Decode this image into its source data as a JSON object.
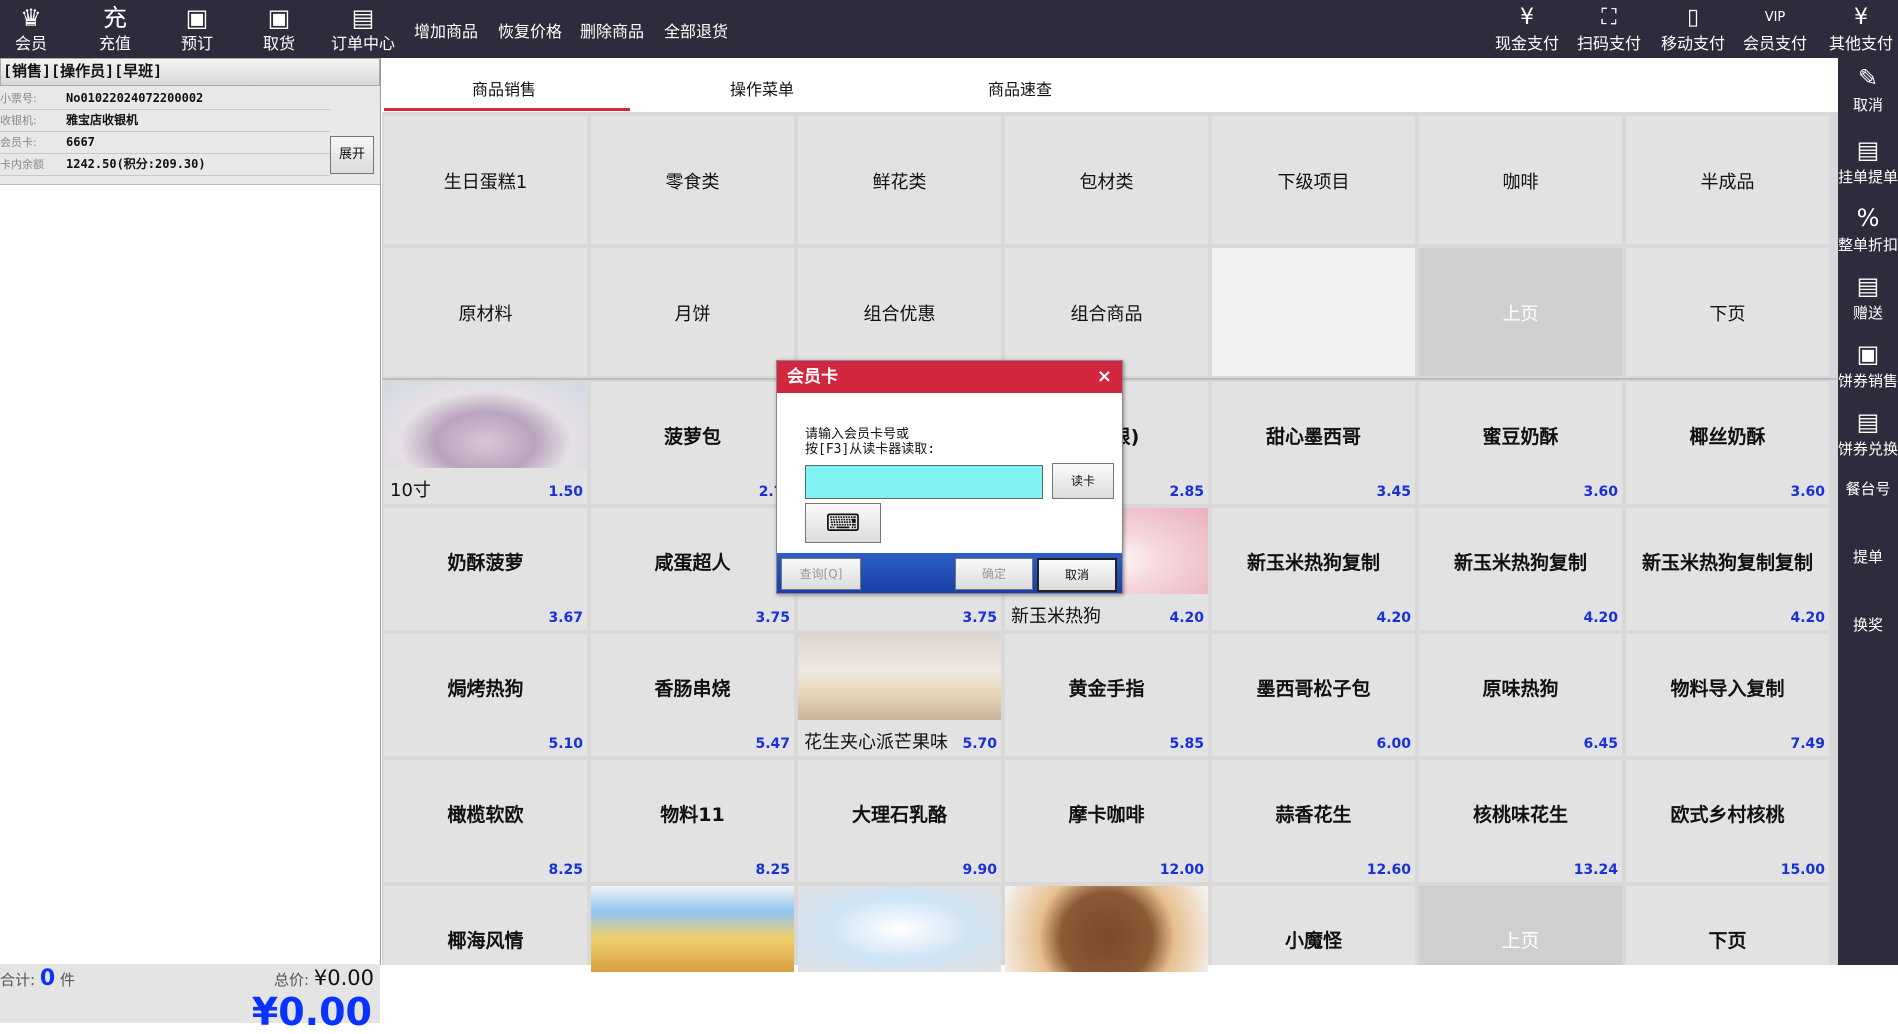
{
  "topbar": {
    "left_buttons": [
      {
        "label": "会员",
        "icon": "crown-icon",
        "glyph": "♛"
      },
      {
        "label": "充值",
        "icon": "recharge-icon",
        "glyph": "充"
      },
      {
        "label": "预订",
        "icon": "calendar-check-icon",
        "glyph": "▣"
      },
      {
        "label": "取货",
        "icon": "calendar-pickup-icon",
        "glyph": "▣"
      },
      {
        "label": "订单中心",
        "icon": "gift-box-icon",
        "glyph": "▤"
      }
    ],
    "links": [
      "增加商品",
      "恢复价格",
      "删除商品",
      "全部退货"
    ],
    "right_buttons": [
      {
        "label": "现金支付",
        "icon": "cash-icon",
        "glyph": "¥"
      },
      {
        "label": "扫码支付",
        "icon": "scan-icon",
        "glyph": "⛶"
      },
      {
        "label": "移动支付",
        "icon": "mobile-pay-icon",
        "glyph": "▯"
      },
      {
        "label": "会员支付",
        "icon": "vip-card-icon",
        "glyph": "VIP"
      },
      {
        "label": "其他支付",
        "icon": "other-pay-icon",
        "glyph": "¥"
      }
    ]
  },
  "left_panel": {
    "header": "[销售][操作员][早班]",
    "rows": [
      {
        "key": "小票号:",
        "value": "No01022024072200002"
      },
      {
        "key": "收银机:",
        "value": "雅宝店收银机"
      },
      {
        "key": "会员卡:",
        "value": "6667"
      },
      {
        "key": "卡内余额",
        "value": "1242.50(积分:209.30)"
      }
    ],
    "expand_label": "展开",
    "count_label": "合计:",
    "count_value": "0",
    "count_unit": "件",
    "total_label": "总价:",
    "total_value": "¥0.00",
    "big_total": "¥0.00"
  },
  "tabs": [
    "商品销售",
    "操作菜单",
    "商品速查"
  ],
  "categories": [
    [
      "生日蛋糕1",
      "零食类",
      "鲜花类",
      "包材类",
      "下级项目",
      "咖啡",
      "半成品"
    ],
    [
      "原材料",
      "月饼",
      "组合优惠",
      "组合商品",
      "",
      "上页",
      "下页"
    ]
  ],
  "products": [
    [
      {
        "name": "",
        "tag": "10寸",
        "price": "1.50",
        "img": "cake1"
      },
      {
        "name": "菠萝包",
        "price": "2.??"
      },
      {
        "name": "",
        "price": ""
      },
      {
        "name": "松培根)",
        "price": "2.85"
      },
      {
        "name": "甜心墨西哥",
        "price": "3.45"
      },
      {
        "name": "蜜豆奶酥",
        "price": "3.60"
      },
      {
        "name": "椰丝奶酥",
        "price": "3.60"
      }
    ],
    [
      {
        "name": "奶酥菠萝",
        "price": "3.67"
      },
      {
        "name": "咸蛋超人",
        "price": "3.75"
      },
      {
        "name": "",
        "price": "3.75"
      },
      {
        "name": "",
        "tag": "新玉米热狗",
        "price": "4.20",
        "img": "cake2"
      },
      {
        "name": "新玉米热狗复制",
        "price": "4.20"
      },
      {
        "name": "新玉米热狗复制",
        "price": "4.20"
      },
      {
        "name": "新玉米热狗复制复制",
        "price": "4.20"
      }
    ],
    [
      {
        "name": "焗烤热狗",
        "price": "5.10"
      },
      {
        "name": "香肠串烧",
        "price": "5.47"
      },
      {
        "name": "",
        "tag": "花生夹心派芒果味",
        "price": "5.70",
        "img": "cake3"
      },
      {
        "name": "黄金手指",
        "price": "5.85"
      },
      {
        "name": "墨西哥松子包",
        "price": "6.00"
      },
      {
        "name": "原味热狗",
        "price": "6.45"
      },
      {
        "name": "物料导入复制",
        "price": "7.49"
      }
    ],
    [
      {
        "name": "橄榄软欧",
        "price": "8.25"
      },
      {
        "name": "物料11",
        "price": "8.25"
      },
      {
        "name": "大理石乳酪",
        "price": "9.90"
      },
      {
        "name": "摩卡咖啡",
        "price": "12.00"
      },
      {
        "name": "蒜香花生",
        "price": "12.60"
      },
      {
        "name": "核桃味花生",
        "price": "13.24"
      },
      {
        "name": "欧式乡村核桃",
        "price": "15.00"
      }
    ],
    [
      {
        "name": "椰海风情",
        "price": ""
      },
      {
        "name": "",
        "price": "",
        "img": "cake4"
      },
      {
        "name": "",
        "price": "",
        "img": "cake5"
      },
      {
        "name": "",
        "price": "",
        "img": "cake6"
      },
      {
        "name": "小魔怪",
        "price": ""
      },
      {
        "name": "上页",
        "price": "",
        "disabled": true
      },
      {
        "name": "下页",
        "price": ""
      }
    ]
  ],
  "right_bar": [
    {
      "label": "取消",
      "icon": "cancel-doc-icon",
      "glyph": "✎"
    },
    {
      "label": "挂单提单",
      "icon": "hold-order-icon",
      "glyph": "▤"
    },
    {
      "label": "整单折扣",
      "icon": "discount-icon",
      "glyph": "%"
    },
    {
      "label": "赠送",
      "icon": "gift-icon",
      "glyph": "▤"
    },
    {
      "label": "饼券销售",
      "icon": "voucher-sale-icon",
      "glyph": "▣"
    },
    {
      "label": "饼券兑换",
      "icon": "voucher-redeem-icon",
      "glyph": "▤"
    },
    {
      "label": "餐台号",
      "icon": "",
      "glyph": ""
    },
    {
      "label": "提单",
      "icon": "",
      "glyph": ""
    },
    {
      "label": "换奖",
      "icon": "",
      "glyph": ""
    }
  ],
  "dialog": {
    "title": "会员卡",
    "close": "×",
    "prompt_line1": "请输入会员卡号或",
    "prompt_line2": "按[F3]从读卡器读取:",
    "input_value": "",
    "read_card": "读卡",
    "keyboard_glyph": "⌨",
    "query": "查询[Q]",
    "confirm": "确定",
    "cancel": "取消"
  },
  "colors": {
    "topbar": "#2f2b3d",
    "accent": "#d2273e",
    "price": "#1a30d8",
    "input": "#7ff3f3"
  }
}
